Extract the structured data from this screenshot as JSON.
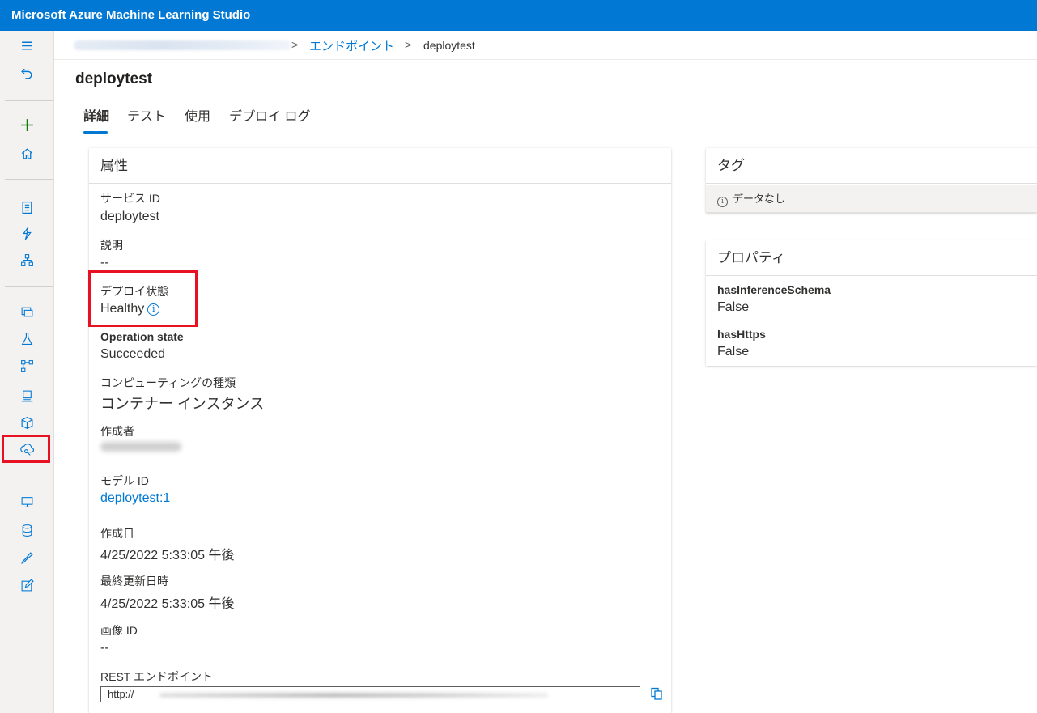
{
  "app": {
    "title": "Microsoft Azure Machine Learning Studio"
  },
  "breadcrumb": {
    "chevron": ">",
    "endpoints": "エンドポイント",
    "current": "deploytest"
  },
  "page": {
    "title": "deploytest"
  },
  "tabs": [
    {
      "label": "詳細",
      "active": true
    },
    {
      "label": "テスト",
      "active": false
    },
    {
      "label": "使用",
      "active": false
    },
    {
      "label": "デプロイ ログ",
      "active": false
    }
  ],
  "attributes": {
    "header": "属性",
    "service_id": {
      "label": "サービス ID",
      "value": "deploytest"
    },
    "description": {
      "label": "説明",
      "value": "--"
    },
    "deploy_state": {
      "label": "デプロイ状態",
      "value": "Healthy",
      "info_glyph": "i"
    },
    "operation_state": {
      "label": "Operation state",
      "value": "Succeeded"
    },
    "compute_type": {
      "label": "コンピューティングの種類",
      "value": "コンテナー インスタンス"
    },
    "creator": {
      "label": "作成者"
    },
    "model_id": {
      "label": "モデル ID",
      "value": "deploytest:1"
    },
    "created": {
      "label": "作成日",
      "value": "4/25/2022 5:33:05 午後"
    },
    "updated": {
      "label": "最終更新日時",
      "value": "4/25/2022 5:33:05 午後"
    },
    "image_id": {
      "label": "画像 ID",
      "value": "--"
    },
    "rest_endpoint": {
      "label": "REST エンドポイント",
      "value": "http://"
    }
  },
  "tags": {
    "header": "タグ",
    "empty_text": "データなし",
    "info_glyph": "i"
  },
  "properties": {
    "header": "プロパティ",
    "items": [
      {
        "label": "hasInferenceSchema",
        "value": "False"
      },
      {
        "label": "hasHttps",
        "value": "False"
      }
    ]
  },
  "nav_icons": [
    "menu-icon",
    "back-icon",
    "plus-icon",
    "home-icon",
    "notebook-icon",
    "automl-icon",
    "designer-icon",
    "datasets-icon",
    "experiments-icon",
    "pipelines-icon",
    "models-icon",
    "cube-icon",
    "endpoints-icon",
    "compute-icon",
    "datastores-icon",
    "labeling-icon",
    "edit-icon"
  ],
  "colors": {
    "accent": "#0078d4",
    "highlight": "#e81123",
    "topbar": "#0078d4"
  }
}
